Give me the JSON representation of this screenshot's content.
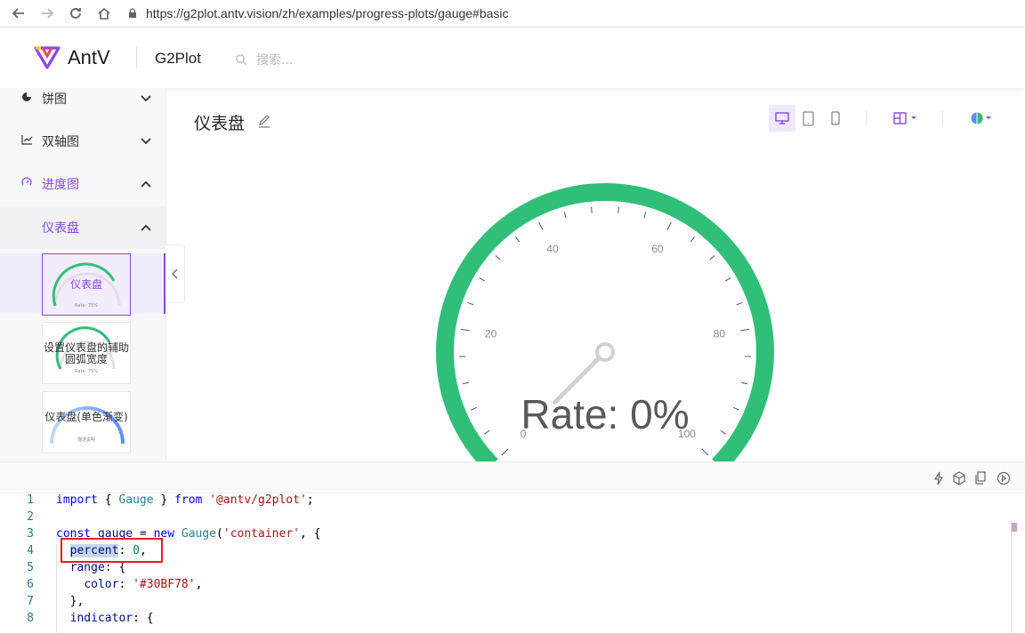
{
  "browser": {
    "url": "https://g2plot.antv.vision/zh/examples/progress-plots/gauge#basic"
  },
  "header": {
    "logo_text": "AntV",
    "product": "G2Plot",
    "search_placeholder": "搜索..."
  },
  "sidebar": {
    "items": [
      {
        "label": "饼图",
        "icon": "pie-icon",
        "expanded": false
      },
      {
        "label": "双轴图",
        "icon": "line-chart-icon",
        "expanded": false
      },
      {
        "label": "进度图",
        "icon": "gauge-icon",
        "expanded": true
      },
      {
        "label": "仪表盘",
        "expanded": true
      }
    ],
    "thumbnails": [
      {
        "title": "仪表盘",
        "sub": "Rate: 75%",
        "selected": true
      },
      {
        "title": "设置仪表盘的辅助圆弧宽度",
        "sub": "Rate: 75%",
        "selected": false
      },
      {
        "title": "仪表盘(单色渐变)",
        "sub": "描述说明",
        "selected": false
      }
    ]
  },
  "main": {
    "title": "仪表盘"
  },
  "gauge": {
    "percent": 0,
    "label": "Rate: 0%",
    "ticks": [
      "0",
      "20",
      "40",
      "60",
      "80",
      "100"
    ],
    "range_color": "#30BF78",
    "indicator_color": "#D0D0D0"
  },
  "code": {
    "lines": [
      {
        "n": "1",
        "text": "import { Gauge } from '@antv/g2plot';"
      },
      {
        "n": "2",
        "text": ""
      },
      {
        "n": "3",
        "text": "const gauge = new Gauge('container', {"
      },
      {
        "n": "4",
        "text": "  percent: 0,"
      },
      {
        "n": "5",
        "text": "  range: {"
      },
      {
        "n": "6",
        "text": "    color: '#30BF78',"
      },
      {
        "n": "7",
        "text": "  },"
      },
      {
        "n": "8",
        "text": "  indicator: {"
      }
    ]
  },
  "colors": {
    "accent": "#8B46E3",
    "highlight_box": "#E02020"
  }
}
